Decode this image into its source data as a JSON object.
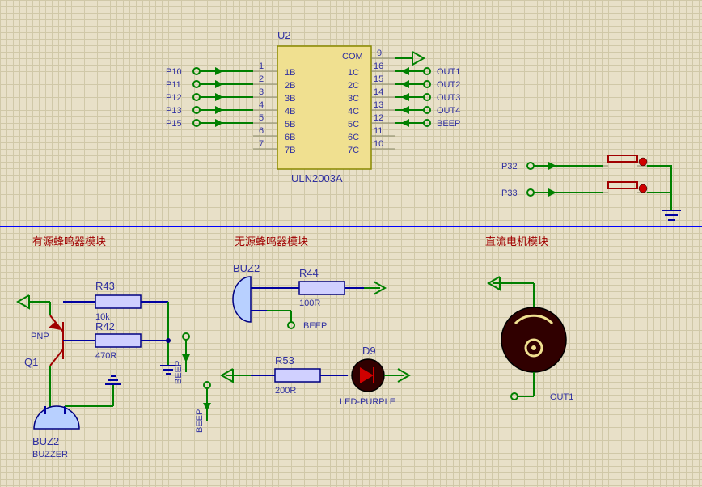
{
  "ic": {
    "ref": "U2",
    "part": "ULN2003A",
    "com": "COM",
    "left_pins": [
      {
        "n": "1",
        "l": "1B"
      },
      {
        "n": "2",
        "l": "2B"
      },
      {
        "n": "3",
        "l": "3B"
      },
      {
        "n": "4",
        "l": "4B"
      },
      {
        "n": "5",
        "l": "5B"
      },
      {
        "n": "6",
        "l": "6B"
      },
      {
        "n": "7",
        "l": "7B"
      }
    ],
    "right_pins": [
      {
        "n": "9",
        "l": ""
      },
      {
        "n": "16",
        "l": "1C"
      },
      {
        "n": "15",
        "l": "2C"
      },
      {
        "n": "14",
        "l": "3C"
      },
      {
        "n": "13",
        "l": "4C"
      },
      {
        "n": "12",
        "l": "5C"
      },
      {
        "n": "11",
        "l": "6C"
      },
      {
        "n": "10",
        "l": "7C"
      }
    ],
    "left_nets": [
      "P10",
      "P11",
      "P12",
      "P13",
      "P15"
    ],
    "right_nets": [
      "OUT1",
      "OUT2",
      "OUT3",
      "OUT4",
      "BEEP"
    ]
  },
  "switches": {
    "nets": [
      "P32",
      "P33"
    ]
  },
  "blk1": {
    "title": "有源蜂鸣器模块",
    "r43": {
      "ref": "R43",
      "val": "10k"
    },
    "r42": {
      "ref": "R42",
      "val": "470R"
    },
    "q1": {
      "ref": "Q1",
      "type": "PNP"
    },
    "buz": {
      "ref": "BUZ2",
      "part": "BUZZER"
    },
    "net1": "BEEP",
    "net2": "BEEP"
  },
  "blk2": {
    "title": "无源蜂鸣器模块",
    "buz": {
      "ref": "BUZ2"
    },
    "r44": {
      "ref": "R44",
      "val": "100R"
    },
    "net": "BEEP",
    "r53": {
      "ref": "R53",
      "val": "200R"
    },
    "d9": {
      "ref": "D9",
      "part": "LED-PURPLE"
    }
  },
  "blk3": {
    "title": "直流电机模块",
    "net": "OUT1"
  }
}
